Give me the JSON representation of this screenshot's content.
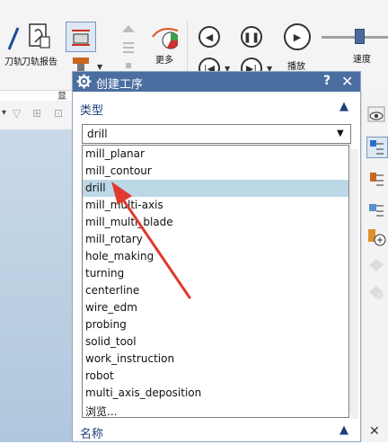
{
  "ribbon": {
    "tool_path_label": "刀轨",
    "tool_path_report_label": "刀轨报告",
    "more_label": "更多",
    "play_label": "播放",
    "speed_label": "速度",
    "group_label": "显"
  },
  "dialog": {
    "title": "创建工序",
    "help": "?",
    "close": "✕",
    "type_section": "类型",
    "name_section": "名称",
    "selected_value": "drill",
    "options": [
      "mill_planar",
      "mill_contour",
      "drill",
      "mill_multi-axis",
      "mill_multi_blade",
      "mill_rotary",
      "hole_making",
      "turning",
      "centerline",
      "wire_edm",
      "probing",
      "solid_tool",
      "work_instruction",
      "robot",
      "multi_axis_deposition",
      "浏览..."
    ]
  },
  "colors": {
    "title_bar": "#4a6ea0",
    "selected_row": "#bcd8e6",
    "annotation_arrow": "#e03a2f"
  }
}
